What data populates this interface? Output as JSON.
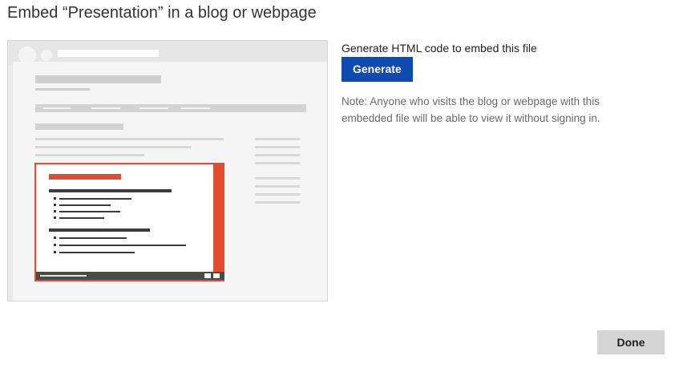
{
  "dialog": {
    "title": "Embed “Presentation” in a blog or webpage"
  },
  "illustration": {
    "icon": "embedded-webpage-illustration",
    "accent_color": "#e34c2f",
    "bar_color": "#4a4a4a"
  },
  "generate": {
    "label": "Generate HTML code to embed this file",
    "button_label": "Generate",
    "button_color": "#0f4ab0"
  },
  "note": {
    "text": "Note: Anyone who visits the blog or webpage with this embedded file will be able to view it without signing in."
  },
  "footer": {
    "done_label": "Done",
    "done_color": "#d4d4d4"
  }
}
